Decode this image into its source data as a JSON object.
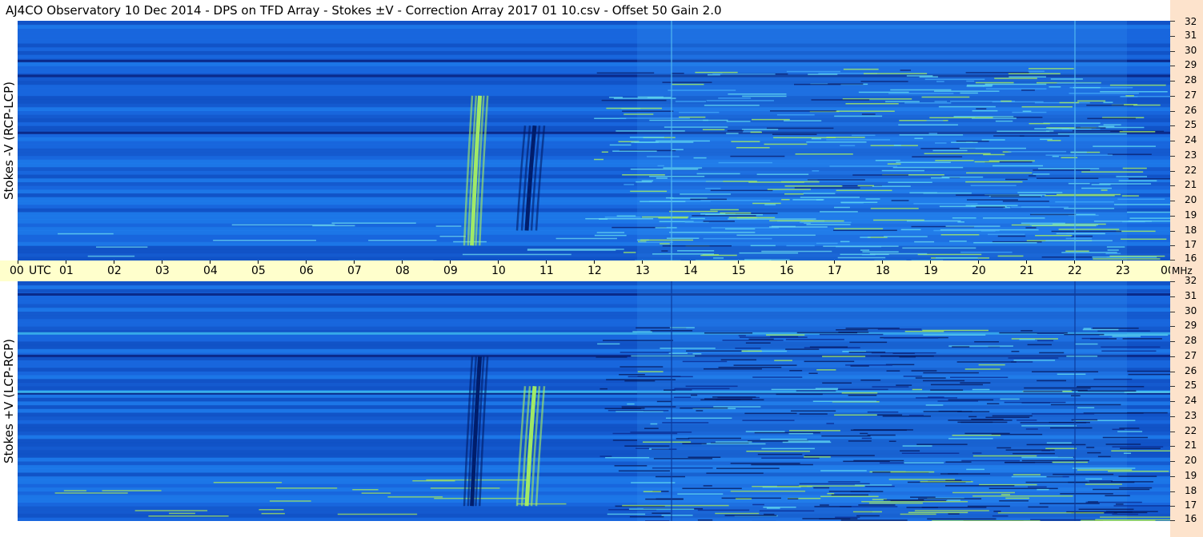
{
  "title": "AJ4CO Observatory  10 Dec 2014  -  DPS on TFD Array  -  Stokes ±V  -  Correction Array 2017 01 10.csv  -  Offset 50  Gain 2.0",
  "chart_data": [
    {
      "type": "heatmap",
      "panel": "top",
      "ylabel": "Stokes -V (RCP-LCP)",
      "xlabel": "UTC",
      "x_ticks": [
        "00",
        "01",
        "02",
        "03",
        "04",
        "05",
        "06",
        "07",
        "08",
        "09",
        "10",
        "11",
        "12",
        "13",
        "14",
        "15",
        "16",
        "17",
        "18",
        "19",
        "20",
        "21",
        "22",
        "23",
        "00"
      ],
      "x_range_hours": [
        0,
        24
      ],
      "y_unit": "MHz",
      "y_ticks": [
        "32",
        "31",
        "30",
        "29",
        "28",
        "27",
        "26",
        "25",
        "24",
        "23",
        "22",
        "21",
        "20",
        "19",
        "18",
        "17",
        "16"
      ],
      "y_range_mhz": [
        16,
        32
      ],
      "features": [
        {
          "label": "burst",
          "start_utc": 9.3,
          "end_utc": 9.7,
          "fmin": 17,
          "fmax": 27,
          "polarity": "bright"
        },
        {
          "label": "burst",
          "start_utc": 10.4,
          "end_utc": 10.9,
          "fmin": 18,
          "fmax": 25,
          "polarity": "dark"
        }
      ],
      "colors": {
        "background": "#1560d8",
        "bright": "#a8f060",
        "dark": "#001a66"
      }
    },
    {
      "type": "heatmap",
      "panel": "bottom",
      "ylabel": "Stokes +V (LCP-RCP)",
      "xlabel": "UTC",
      "x_range_hours": [
        0,
        24
      ],
      "y_unit": "MHz",
      "y_ticks": [
        "32",
        "31",
        "30",
        "29",
        "28",
        "27",
        "26",
        "25",
        "24",
        "23",
        "22",
        "21",
        "20",
        "19",
        "18",
        "17",
        "16"
      ],
      "y_range_mhz": [
        16,
        32
      ],
      "features": [
        {
          "label": "burst",
          "start_utc": 9.3,
          "end_utc": 9.7,
          "fmin": 17,
          "fmax": 27,
          "polarity": "dark"
        },
        {
          "label": "burst",
          "start_utc": 10.4,
          "end_utc": 10.9,
          "fmin": 17,
          "fmax": 25,
          "polarity": "bright"
        }
      ],
      "colors": {
        "background": "#1560d8",
        "bright": "#a8f060",
        "dark": "#001a66"
      }
    }
  ]
}
